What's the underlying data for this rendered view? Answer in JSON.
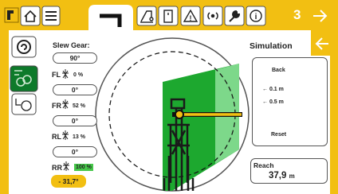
{
  "colors": {
    "accent": "#f2bf12",
    "green": "#1da82f",
    "light_green": "#7dd88a"
  },
  "topbar": {
    "page_number": "3",
    "icons": [
      "app-logo-icon",
      "home-icon",
      "menu-list-icon",
      "crane-boom-icon",
      "crane-lift-icon",
      "door-icon",
      "warning-icon",
      "radio-signal-icon",
      "wrench-icon",
      "info-icon",
      "arrow-right-icon"
    ]
  },
  "left_panel": {
    "slew_gear_label": "Slew Gear:",
    "slew_gear_value": "90°",
    "outriggers": [
      {
        "label": "FL",
        "percent": "0 %",
        "angle": "0°"
      },
      {
        "label": "FR",
        "percent": "52 %",
        "angle": "0°"
      },
      {
        "label": "RL",
        "percent": "13 %",
        "angle": "0°"
      },
      {
        "label": "RR",
        "percent": "100 %"
      }
    ],
    "slew_angle": "- 31,7°"
  },
  "simulation": {
    "title": "Simulation",
    "back_label": "Back",
    "step_small": "← 0.1 m",
    "step_large": "← 0.5 m",
    "reset_label": "Reset"
  },
  "reach": {
    "label": "Reach",
    "value": "37,9",
    "unit": "m"
  }
}
